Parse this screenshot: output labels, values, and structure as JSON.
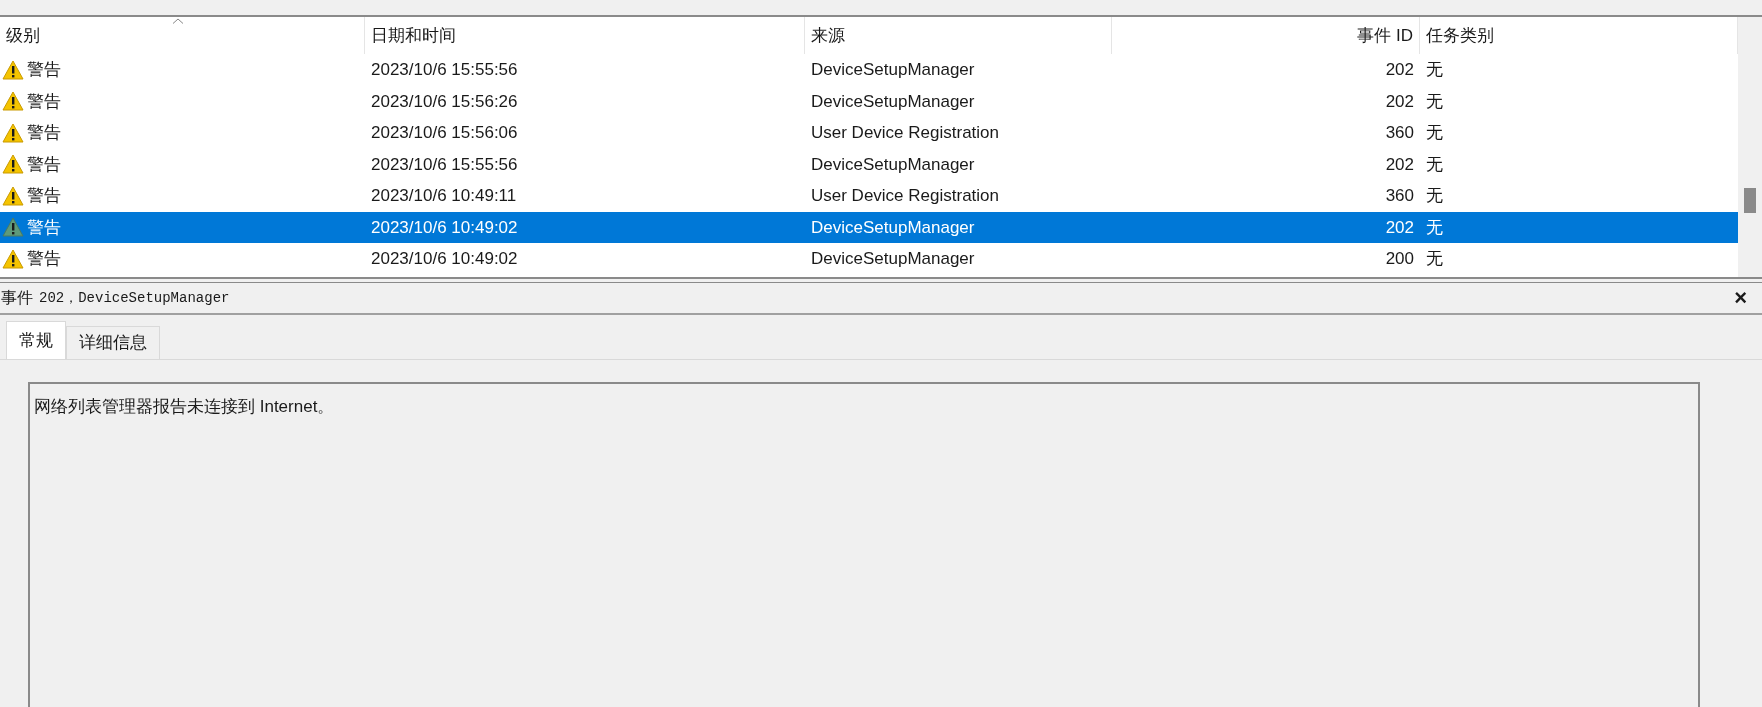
{
  "table": {
    "columns": [
      {
        "label": "级别",
        "sorted": true
      },
      {
        "label": "日期和时间",
        "sorted": false
      },
      {
        "label": "来源",
        "sorted": false
      },
      {
        "label": "事件 ID",
        "sorted": false
      },
      {
        "label": "任务类别",
        "sorted": false
      }
    ],
    "rows": [
      {
        "level": "警告",
        "datetime": "2023/10/6 15:55:56",
        "source": "DeviceSetupManager",
        "event_id": "202",
        "category": "无",
        "selected": false
      },
      {
        "level": "警告",
        "datetime": "2023/10/6 15:56:26",
        "source": "DeviceSetupManager",
        "event_id": "202",
        "category": "无",
        "selected": false
      },
      {
        "level": "警告",
        "datetime": "2023/10/6 15:56:06",
        "source": "User Device Registration",
        "event_id": "360",
        "category": "无",
        "selected": false
      },
      {
        "level": "警告",
        "datetime": "2023/10/6 15:55:56",
        "source": "DeviceSetupManager",
        "event_id": "202",
        "category": "无",
        "selected": false
      },
      {
        "level": "警告",
        "datetime": "2023/10/6 10:49:11",
        "source": "User Device Registration",
        "event_id": "360",
        "category": "无",
        "selected": false
      },
      {
        "level": "警告",
        "datetime": "2023/10/6 10:49:02",
        "source": "DeviceSetupManager",
        "event_id": "202",
        "category": "无",
        "selected": true
      },
      {
        "level": "警告",
        "datetime": "2023/10/6 10:49:02",
        "source": "DeviceSetupManager",
        "event_id": "200",
        "category": "无",
        "selected": false
      }
    ]
  },
  "detail": {
    "title_label": "事件",
    "title_value": "202，DeviceSetupManager",
    "close": "×",
    "tabs": [
      {
        "label": "常规",
        "selected": true
      },
      {
        "label": "详细信息",
        "selected": false
      }
    ],
    "message": "网络列表管理器报告未连接到 Internet。"
  }
}
